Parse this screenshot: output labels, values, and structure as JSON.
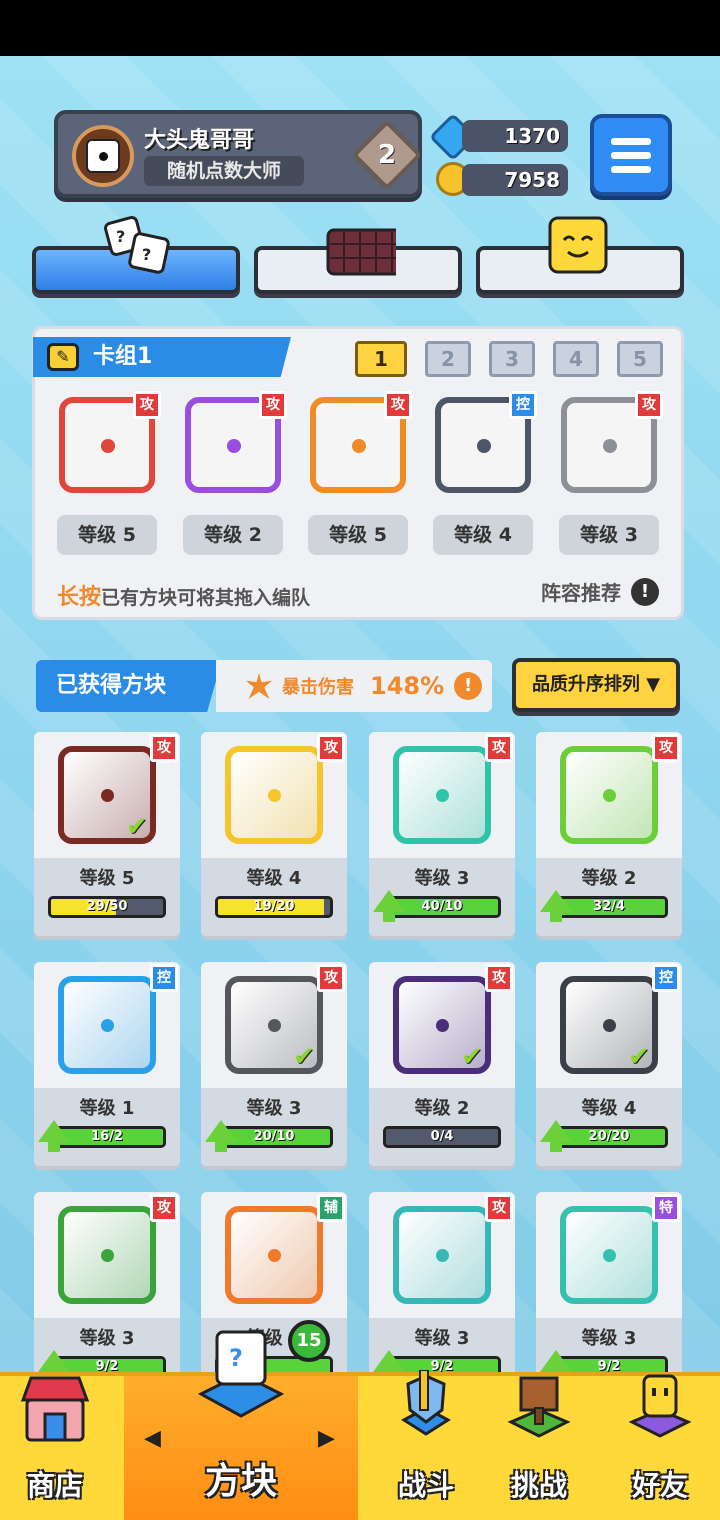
{
  "profile": {
    "name": "大头鬼哥哥",
    "title": "随机点数大师",
    "rank": "2"
  },
  "currency": {
    "gems": "1370",
    "coins": "7958"
  },
  "deck": {
    "title": "卡组1",
    "tabs": [
      "1",
      "2",
      "3",
      "4",
      "5"
    ],
    "active_tab": "1",
    "slots": [
      {
        "level": "等级 5",
        "badge": "攻",
        "color": "#e2453a"
      },
      {
        "level": "等级 2",
        "badge": "攻",
        "color": "#9a4ee0"
      },
      {
        "level": "等级 5",
        "badge": "攻",
        "color": "#f18b27"
      },
      {
        "level": "等级 4",
        "badge": "控",
        "color": "#4d5666"
      },
      {
        "level": "等级 3",
        "badge": "攻",
        "color": "#8d9096"
      }
    ],
    "hint_highlight": "长按",
    "hint_text": "已有方块可将其拖入编队",
    "recommend": "阵容推荐"
  },
  "collection": {
    "title": "已获得方块",
    "crit_label": "暴击伤害",
    "crit_value": "148%",
    "sort_label": "品质升序排列 ▼",
    "cards": [
      {
        "level": "等级 5",
        "progress": "29/50",
        "badge": "攻",
        "color": "#7a2a22",
        "fill": 0.58,
        "bar": "#f5e42b",
        "equipped": true,
        "upgradable": false
      },
      {
        "level": "等级 4",
        "progress": "19/20",
        "badge": "攻",
        "color": "#f6c52b",
        "fill": 0.95,
        "bar": "#f5e42b",
        "equipped": false,
        "upgradable": false
      },
      {
        "level": "等级 3",
        "progress": "40/10",
        "badge": "攻",
        "color": "#2fc3a7",
        "fill": 1.0,
        "bar": "#58d43a",
        "equipped": false,
        "upgradable": true
      },
      {
        "level": "等级 2",
        "progress": "32/4",
        "badge": "攻",
        "color": "#6bcf3a",
        "fill": 1.0,
        "bar": "#58d43a",
        "equipped": false,
        "upgradable": true
      },
      {
        "level": "等级 1",
        "progress": "16/2",
        "badge": "控",
        "color": "#2aa0e8",
        "fill": 1.0,
        "bar": "#58d43a",
        "equipped": false,
        "upgradable": true
      },
      {
        "level": "等级 3",
        "progress": "20/10",
        "badge": "攻",
        "color": "#55575d",
        "fill": 1.0,
        "bar": "#58d43a",
        "equipped": true,
        "upgradable": true
      },
      {
        "level": "等级 2",
        "progress": "0/4",
        "badge": "攻",
        "color": "#4a2e7a",
        "fill": 0.0,
        "bar": "#58d43a",
        "equipped": true,
        "upgradable": false
      },
      {
        "level": "等级 4",
        "progress": "20/20",
        "badge": "控",
        "color": "#3b3f48",
        "fill": 1.0,
        "bar": "#58d43a",
        "equipped": true,
        "upgradable": true
      },
      {
        "level": "等级 3",
        "progress": "9/2",
        "badge": "攻",
        "color": "#3aa33a",
        "fill": 1.0,
        "bar": "#58d43a",
        "equipped": false,
        "upgradable": true
      },
      {
        "level": "等级 3",
        "progress": "",
        "badge": "辅",
        "color": "#f17a2a",
        "fill": 1.0,
        "bar": "#58d43a",
        "equipped": false,
        "upgradable": false
      },
      {
        "level": "等级 3",
        "progress": "9/2",
        "badge": "攻",
        "color": "#37b8b8",
        "fill": 1.0,
        "bar": "#58d43a",
        "equipped": false,
        "upgradable": true
      },
      {
        "level": "等级 3",
        "progress": "9/2",
        "badge": "特",
        "color": "#36c0b0",
        "fill": 1.0,
        "bar": "#58d43a",
        "equipped": false,
        "upgradable": true
      }
    ]
  },
  "nav": {
    "shop": "商店",
    "blocks": "方块",
    "battle": "战斗",
    "challenge": "挑战",
    "friends": "好友",
    "blocks_badge": "15"
  },
  "badge_colors": {
    "攻": "#e23a3a",
    "控": "#2a8ee8",
    "辅": "#2aa36a",
    "特": "#9a4ee0"
  }
}
